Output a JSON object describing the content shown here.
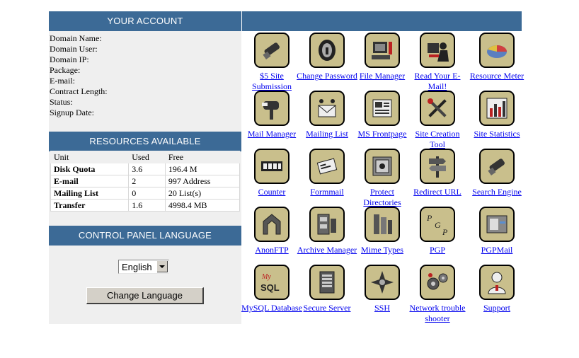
{
  "account": {
    "header": "YOUR ACCOUNT",
    "fields": [
      {
        "label": "Domain Name:"
      },
      {
        "label": "Domain User:"
      },
      {
        "label": "Domain IP:"
      },
      {
        "label": "Package:"
      },
      {
        "label": "E-mail:"
      },
      {
        "label": "Contract Length:"
      },
      {
        "label": "Status:"
      },
      {
        "label": "Signup Date:"
      }
    ]
  },
  "resources": {
    "header": "RESOURCES AVAILABLE",
    "columns": [
      "Unit",
      "Used",
      "Free"
    ],
    "rows": [
      {
        "unit": "Disk Quota",
        "used": "3.6",
        "free": "196.4 M"
      },
      {
        "unit": "E-mail",
        "used": "2",
        "free": "997 Address"
      },
      {
        "unit": "Mailing List",
        "used": "0",
        "free": "20 List(s)"
      },
      {
        "unit": "Transfer",
        "used": "1.6",
        "free": "4998.4 MB"
      }
    ]
  },
  "language": {
    "header": "CONTROL PANEL LANGUAGE",
    "selected": "English",
    "button": "Change Language"
  },
  "tools": [
    {
      "label": "$5 Site Submission",
      "icon": "flashlight-icon"
    },
    {
      "label": "Change Password",
      "icon": "keyhole-icon"
    },
    {
      "label": "File Manager",
      "icon": "computer-icon"
    },
    {
      "label": "Read Your E-Mail!",
      "icon": "reader-icon"
    },
    {
      "label": "Resource Meter",
      "icon": "pie-chart-icon"
    },
    {
      "label": "Mail Manager",
      "icon": "mailbox-icon"
    },
    {
      "label": "Mailing List",
      "icon": "mailing-list-icon"
    },
    {
      "label": "MS Frontpage",
      "icon": "newspaper-icon"
    },
    {
      "label": "Site Creation Tool",
      "icon": "tools-icon"
    },
    {
      "label": "Site Statistics",
      "icon": "bar-chart-icon"
    },
    {
      "label": "Counter",
      "icon": "counter-icon"
    },
    {
      "label": "Formmail",
      "icon": "form-mail-icon"
    },
    {
      "label": "Protect Directories",
      "icon": "safe-icon"
    },
    {
      "label": "Redirect URL",
      "icon": "signpost-icon"
    },
    {
      "label": "Search Engine",
      "icon": "flashlight-icon"
    },
    {
      "label": "AnonFTP",
      "icon": "ftp-icon"
    },
    {
      "label": "Archive Manager",
      "icon": "archive-icon"
    },
    {
      "label": "Mime Types",
      "icon": "mime-icon"
    },
    {
      "label": "PGP",
      "icon": "pgp-icon"
    },
    {
      "label": "PGPMail",
      "icon": "pgp-mail-icon"
    },
    {
      "label": "MySQL Database",
      "icon": "mysql-icon"
    },
    {
      "label": "Secure Server",
      "icon": "server-icon"
    },
    {
      "label": "SSH",
      "icon": "ssh-icon"
    },
    {
      "label": "Network trouble shooter",
      "icon": "network-icon"
    },
    {
      "label": "Support",
      "icon": "support-icon"
    }
  ]
}
